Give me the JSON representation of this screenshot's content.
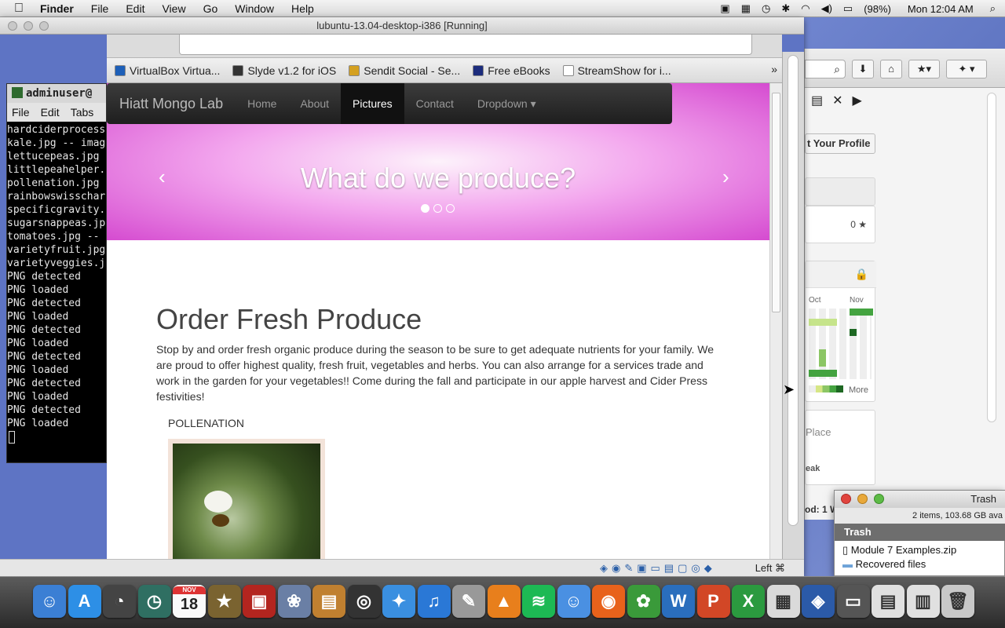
{
  "menubar": {
    "apple": "",
    "app": "Finder",
    "items": [
      "File",
      "Edit",
      "View",
      "Go",
      "Window",
      "Help"
    ],
    "battery": "(98%)",
    "clock": "Mon 12:04 AM"
  },
  "vbox": {
    "title": "lubuntu-13.04-desktop-i386 [Running]",
    "status_right": "Left ⌘"
  },
  "terminal": {
    "title": "adminuser@",
    "menu": [
      "File",
      "Edit",
      "Tabs"
    ],
    "lines": [
      "hardciderprocess",
      "kale.jpg -- imag",
      "lettucepeas.jpg",
      "littlepeahelper.",
      "pollenation.jpg",
      "rainbowswisschar",
      "specificgravity.",
      "sugarsnappeas.jp",
      "tomatoes.jpg --",
      "varietyfruit.jpg",
      "varietyveggies.j",
      "PNG detected",
      "PNG loaded",
      "PNG detected",
      "PNG loaded",
      "PNG detected",
      "PNG loaded",
      "PNG detected",
      "PNG loaded",
      "PNG detected",
      "PNG loaded",
      "PNG detected",
      "PNG loaded"
    ]
  },
  "bookmarks": [
    {
      "label": "VirtualBox Virtua...",
      "color": "#1d5fb8"
    },
    {
      "label": "Slyde v1.2 for iOS",
      "color": "#333333"
    },
    {
      "label": "Sendit Social - Se...",
      "color": "#d4a020"
    },
    {
      "label": "Free eBooks",
      "color": "#1c2c7c"
    },
    {
      "label": "StreamShow for i...",
      "color": "#ffffff"
    }
  ],
  "site": {
    "brand": "Hiatt Mongo Lab",
    "nav": [
      "Home",
      "About",
      "Pictures",
      "Contact",
      "Dropdown ▾"
    ],
    "active_nav": "Pictures",
    "carousel_heading": "What do we produce?",
    "prev": "‹",
    "next": "›",
    "heading": "Order Fresh Produce",
    "paragraph": "Stop by and order fresh organic produce during the season to be sure to get adequate nutrients for your family. We are proud to offer highest quality, fresh fruit, vegetables and herbs. You can also arrange for a services trade and work in the garden for your vegetables!! Come during the fall and participate in our apple harvest and Cider Press festivities!",
    "caption": "POLLENATION"
  },
  "right_window": {
    "profile_btn": "t Your Profile",
    "rating": "0 ★",
    "months": [
      "Oct",
      "Nov"
    ],
    "more": "More",
    "place": "Place",
    "peak": "eak",
    "pod": "od: 1 W"
  },
  "trash": {
    "title": "Trash",
    "info": "2 items, 103.68 GB ava",
    "header": "Trash",
    "items": [
      "Module 7 Examples.zip",
      "Recovered files"
    ]
  },
  "dock": {
    "calendar_date": "18",
    "calendar_month": "NOV"
  }
}
